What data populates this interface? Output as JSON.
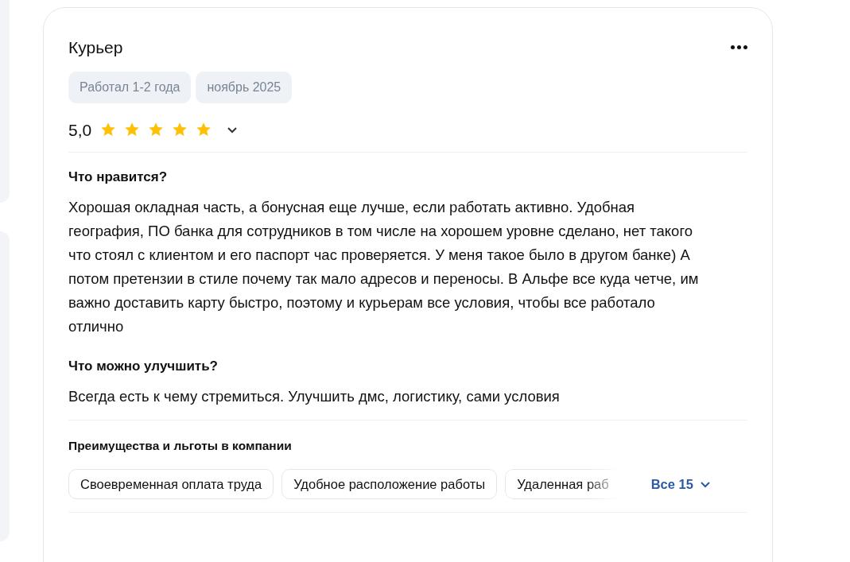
{
  "review": {
    "title": "Курьер",
    "tags": [
      "Работал 1-2 года",
      "ноябрь 2025"
    ],
    "rating": "5,0",
    "stars": 5,
    "sections": [
      {
        "heading": "Что нравится?",
        "text": "Хорошая окладная часть, а бонусная еще лучше, если работать активно. Удобная география, ПО банка для сотрудников в том числе на хорошем уровне сделано, нет такого что стоял с клиентом и его паспорт час проверяется. У меня такое было в другом банке) А потом претензии в стиле почему так мало адресов и переносы. В Альфе все куда четче, им важно доставить карту быстро, поэтому и курьерам все условия, чтобы все работало отлично"
      },
      {
        "heading": "Что можно улучшить?",
        "text": "Всегда есть к чему стремиться. Улучшить дмс, логистику, сами условия"
      }
    ],
    "benefits": {
      "heading": "Преимущества и льготы в компании",
      "items": [
        "Своевременная оплата труда",
        "Удобное расположение работы",
        "Удаленная раб"
      ],
      "more": "Все 15"
    }
  }
}
